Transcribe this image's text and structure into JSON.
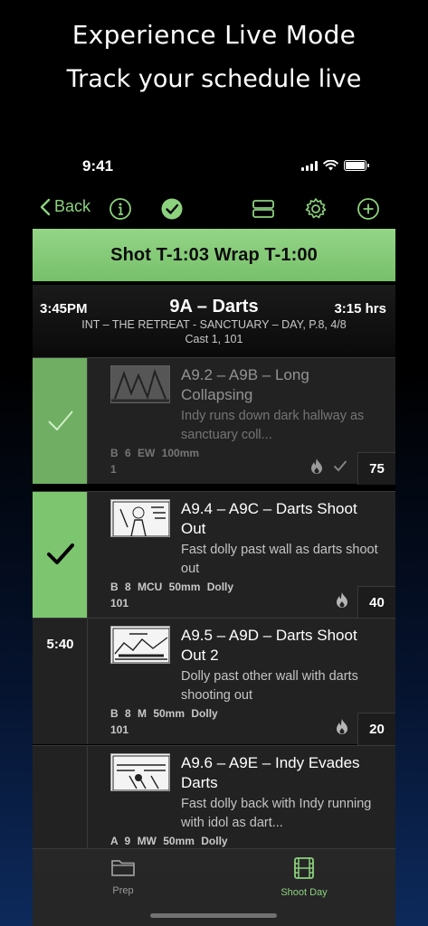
{
  "promo": {
    "title": "Experience Live Mode",
    "subtitle": "Track your schedule live"
  },
  "status_bar": {
    "time": "9:41"
  },
  "toolbar": {
    "back_label": "Back"
  },
  "banner": {
    "text": "Shot T-1:03  Wrap T-1:00"
  },
  "scene": {
    "start_time": "3:45PM",
    "title": "9A – Darts",
    "duration": "3:15 hrs",
    "description": "INT – THE RETREAT - SANCTUARY – DAY, P.8, 4/8",
    "cast": "Cast 1, 101"
  },
  "shots": [
    {
      "left_time": "",
      "status": "completed",
      "title": "A9.2 – A9B – Long Collapsing",
      "description": "Indy runs down dark hallway as sanctuary coll...",
      "specs": "B  6  EW  100mm",
      "cast": "1",
      "count": "75"
    },
    {
      "left_time": "",
      "status": "current",
      "title": "A9.4 – A9C – Darts Shoot Out",
      "description": "Fast dolly past wall as darts shoot out",
      "specs": "B  8  MCU  50mm  Dolly",
      "cast": "101",
      "count": "40"
    },
    {
      "left_time": "5:40",
      "status": "pending",
      "title": "A9.5 – A9D – Darts Shoot Out 2",
      "description": "Dolly past other wall with darts shooting out",
      "specs": "B  8  M  50mm  Dolly",
      "cast": "101",
      "count": "20"
    },
    {
      "left_time": "",
      "status": "pending",
      "title": "A9.6 – A9E – Indy Evades Darts",
      "description": "Fast dolly back with Indy running with idol as dart...",
      "specs": "A  9  MW  50mm  Dolly",
      "cast": "",
      "count": ""
    }
  ],
  "tabbar": {
    "tabs": [
      {
        "label": "Prep",
        "icon": "folder-icon",
        "active": false
      },
      {
        "label": "Shoot Day",
        "icon": "film-icon",
        "active": true
      }
    ]
  },
  "colors": {
    "accent": "#8cd17d",
    "banner": "#7dc56f",
    "row_bg": "#222222"
  }
}
